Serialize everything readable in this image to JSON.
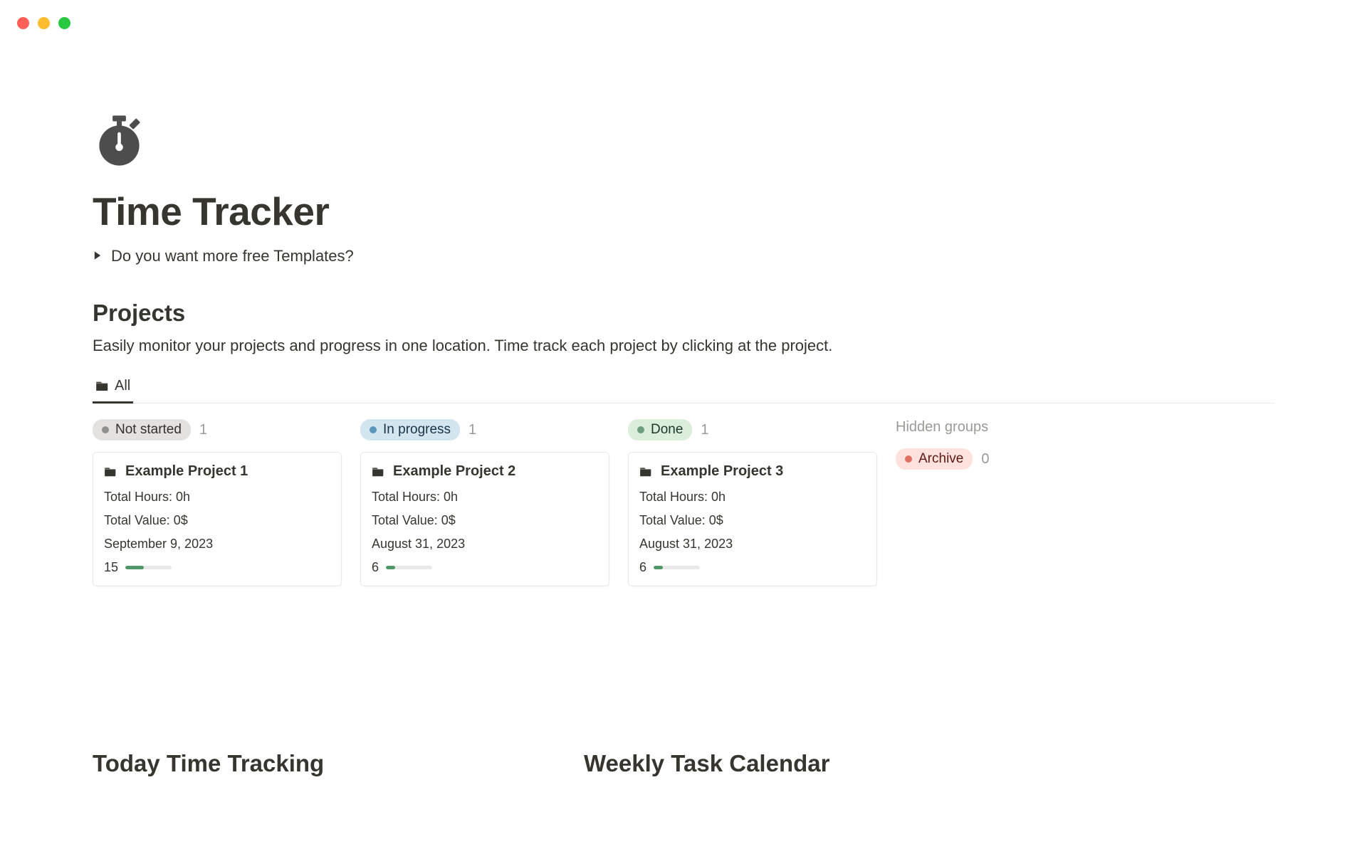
{
  "page": {
    "title": "Time Tracker",
    "toggle_text": "Do you want more free Templates?"
  },
  "projects_section": {
    "title": "Projects",
    "description": "Easily monitor your projects and progress in one location. Time track each project by clicking at the project.",
    "tab_label": "All"
  },
  "columns": [
    {
      "status": "Not started",
      "pill_class": "pill-grey",
      "count": "1"
    },
    {
      "status": "In progress",
      "pill_class": "pill-blue",
      "count": "1"
    },
    {
      "status": "Done",
      "pill_class": "pill-green",
      "count": "1"
    }
  ],
  "cards": [
    {
      "title": "Example Project 1",
      "total_hours": "Total Hours: 0h",
      "total_value": "Total Value: 0$",
      "date": "September 9, 2023",
      "progress_num": "15",
      "progress_pct": 40
    },
    {
      "title": "Example Project 2",
      "total_hours": "Total Hours: 0h",
      "total_value": "Total Value: 0$",
      "date": "August 31, 2023",
      "progress_num": "6",
      "progress_pct": 20
    },
    {
      "title": "Example Project 3",
      "total_hours": "Total Hours: 0h",
      "total_value": "Total Value: 0$",
      "date": "August 31, 2023",
      "progress_num": "6",
      "progress_pct": 20
    }
  ],
  "hidden": {
    "title": "Hidden groups",
    "archive_label": "Archive",
    "archive_count": "0"
  },
  "bottom": {
    "left_title": "Today Time Tracking",
    "right_title": "Weekly Task Calendar"
  }
}
